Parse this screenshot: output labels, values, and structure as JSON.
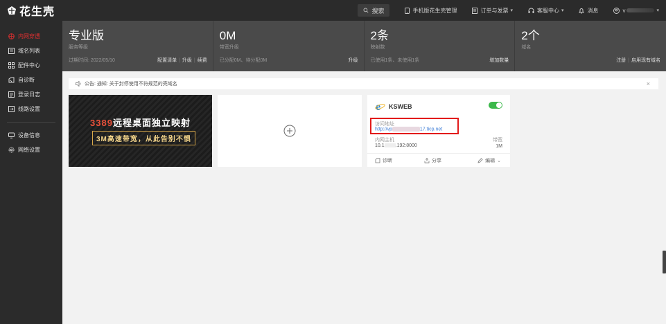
{
  "brand": {
    "name": "花生壳"
  },
  "topbar": {
    "search": "搜索",
    "mobile": "手机版花生壳管理",
    "orders": "订单与发票",
    "support": "客服中心",
    "messages": "消息",
    "user": "v"
  },
  "sidebar": {
    "items": [
      {
        "label": "内网穿透",
        "active": true
      },
      {
        "label": "域名列表"
      },
      {
        "label": "配件中心"
      },
      {
        "label": "自诊断"
      },
      {
        "label": "登录日志"
      },
      {
        "label": "线路设置"
      }
    ],
    "items2": [
      {
        "label": "设备信息"
      },
      {
        "label": "网络设置"
      }
    ]
  },
  "stats": [
    {
      "big": "专业版",
      "sub": "服务等级",
      "foot": "过期时间: 2022/05/10",
      "links": [
        "配置清单",
        "升级",
        "续费"
      ]
    },
    {
      "big": "0M",
      "sub": "带宽升级",
      "foot": "已分配0M、待分配0M",
      "links": [
        "升级"
      ]
    },
    {
      "big": "2条",
      "sub": "映射数",
      "foot": "已使用1条、未使用1条",
      "links": [
        "增加数量"
      ]
    },
    {
      "big": "2个",
      "sub": "域名",
      "foot": "",
      "links": [
        "注册",
        "启用现有域名"
      ]
    }
  ],
  "notice": {
    "text": "公告: 通知: 关于封停使用不符规范的壳域名"
  },
  "banner": {
    "line1_num": "3389",
    "line1_rest": "远程桌面独立映射",
    "line2": "3M高速带宽，从此告别不惧"
  },
  "service": {
    "name": "KSWEB",
    "access_label": "访问地址",
    "url_prefix": "http://vp",
    "url_suffix": "17.ticp.net",
    "host_label": "内网主机",
    "host_prefix": "10.1",
    "host_suffix": ".192:8000",
    "bw_label": "带宽",
    "bw_value": "1M",
    "actions": {
      "diagnose": "诊断",
      "share": "分享",
      "edit": "编辑"
    }
  }
}
